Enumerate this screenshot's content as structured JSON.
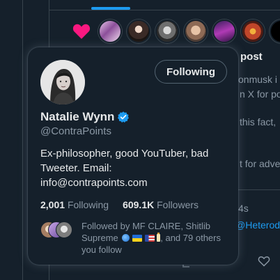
{
  "background": {
    "post_title_fragment": "post",
    "mention_fragment": "onmusk i",
    "line_fragment": "n X for po",
    "text_fragment_1": "this fact,",
    "text_fragment_2": "t for adve",
    "time_fragment": "4s",
    "link_fragment": "@Heterod"
  },
  "hover_card": {
    "follow_button_label": "Following",
    "display_name": "Natalie Wynn",
    "verified": true,
    "handle": "@ContraPoints",
    "bio_line_1": "Ex-philosopher, good YouTuber, bad Tweeter. Email:",
    "bio_line_2": "info@contrapoints.com",
    "following_count": "2,001",
    "following_label": "Following",
    "followers_count": "609.1K",
    "followers_label": "Followers",
    "followed_by_prefix": "Followed by MF CLAIRE, Shitlib Supreme",
    "followed_by_suffix": ", and 79 others you follow"
  },
  "colors": {
    "background": "#15202b",
    "accent": "#1d9bf0",
    "secondary_text": "#8b98a5",
    "heart": "#f91880"
  },
  "icons": [
    "heart-icon",
    "verified-badge-icon",
    "globe-emoji",
    "ukraine-flag-emoji",
    "us-flag-emoji",
    "candle-emoji",
    "like-icon",
    "share-icon"
  ]
}
